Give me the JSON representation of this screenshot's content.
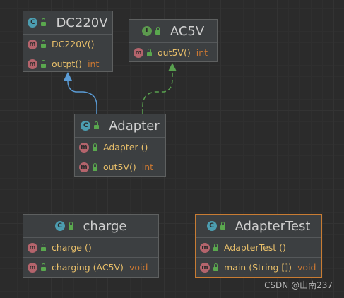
{
  "classes": {
    "dc220v": {
      "badge": "C",
      "name": "DC220V",
      "members": [
        {
          "badge": "m",
          "name": "DC220V()",
          "type": ""
        },
        {
          "badge": "m",
          "name": "outpt()",
          "type": "int"
        }
      ]
    },
    "ac5v": {
      "badge": "I",
      "name": "AC5V",
      "members": [
        {
          "badge": "m",
          "name": "out5V()",
          "type": "int"
        }
      ]
    },
    "adapter": {
      "badge": "C",
      "name": "Adapter",
      "members": [
        {
          "badge": "m",
          "name": "Adapter ()",
          "type": ""
        },
        {
          "badge": "m",
          "name": "out5V()",
          "type": "int"
        }
      ]
    },
    "charge": {
      "badge": "C",
      "name": "charge",
      "members": [
        {
          "badge": "m",
          "name": "charge ()",
          "type": ""
        },
        {
          "badge": "m",
          "name": "charging (AC5V)",
          "type": "void"
        }
      ]
    },
    "adaptertest": {
      "badge": "C",
      "name": "AdapterTest",
      "members": [
        {
          "badge": "m",
          "name": "AdapterTest ()",
          "type": ""
        },
        {
          "badge": "m",
          "name": "main (String [])",
          "type": "void"
        }
      ]
    }
  },
  "edges": [
    {
      "from": "Adapter",
      "to": "DC220V",
      "kind": "extends",
      "color": "#5a9bd5"
    },
    {
      "from": "Adapter",
      "to": "AC5V",
      "kind": "implements",
      "color": "#59a14f"
    }
  ],
  "colors": {
    "class_badge": "#4c9db0",
    "interface_badge": "#5c9a4e",
    "method_badge": "#b4646c",
    "method_name": "#e8bf6a",
    "return_type": "#cc7832",
    "selected_border": "#c87c33"
  },
  "watermark": "CSDN @山南237"
}
